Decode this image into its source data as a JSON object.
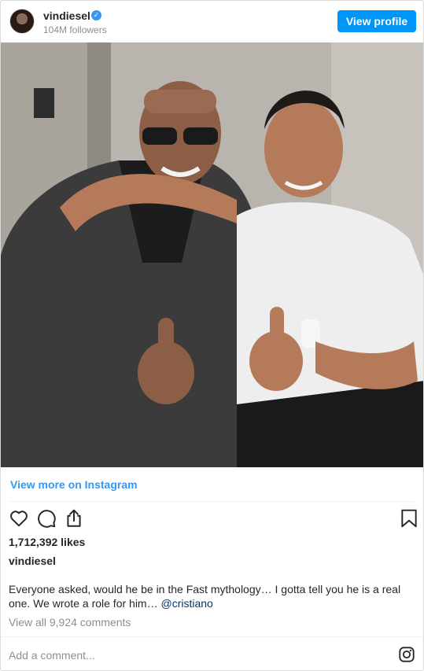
{
  "header": {
    "username": "vindiesel",
    "followers": "104M followers",
    "view_profile_label": "View profile",
    "verified_mark": "✓"
  },
  "post": {
    "view_more_label": "View more on Instagram",
    "likes": "1,712,392 likes",
    "caption_user": "vindiesel",
    "caption_text": "Everyone asked, would he be in the Fast mythology… I gotta tell you he is a real one. We wrote a role for him… ",
    "caption_mention": "@cristiano",
    "view_comments": "View all 9,924 comments",
    "add_comment_placeholder": "Add a comment..."
  },
  "icons": {
    "like": "heart-icon",
    "comment": "comment-icon",
    "share": "share-icon",
    "save": "bookmark-icon",
    "instagram": "instagram-icon"
  },
  "colors": {
    "accent": "#0095f6",
    "link": "#3897f0",
    "muted": "#8e8e8e",
    "text": "#262626"
  }
}
